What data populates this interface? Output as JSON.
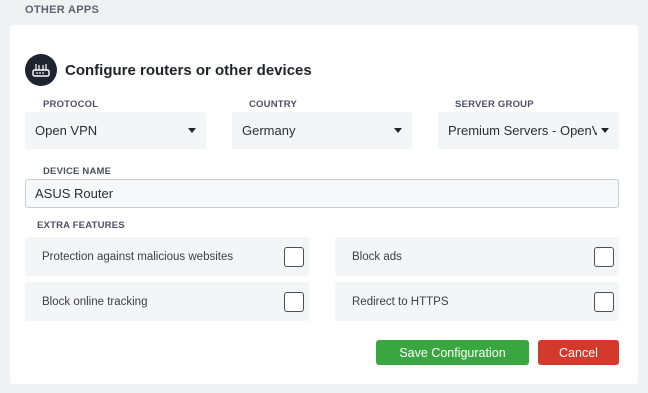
{
  "section": {
    "title": "OTHER APPS"
  },
  "header": {
    "title": "Configure routers or other devices",
    "icon": "router-icon"
  },
  "protocol": {
    "label": "PROTOCOL",
    "value": "Open VPN"
  },
  "country": {
    "label": "COUNTRY",
    "value": "Germany"
  },
  "server_group": {
    "label": "SERVER GROUP",
    "value": "Premium Servers - OpenV"
  },
  "device_name": {
    "label": "DEVICE NAME",
    "value": "ASUS Router"
  },
  "extra_features": {
    "label": "EXTRA FEATURES",
    "items": [
      {
        "label": "Protection against malicious websites",
        "checked": false
      },
      {
        "label": "Block ads",
        "checked": false
      },
      {
        "label": "Block online tracking",
        "checked": false
      },
      {
        "label": "Redirect to HTTPS",
        "checked": false
      }
    ]
  },
  "actions": {
    "save_label": "Save Configuration",
    "cancel_label": "Cancel"
  },
  "colors": {
    "save": "#3aa640",
    "cancel": "#d33a2c",
    "badge": "#1e2430"
  }
}
